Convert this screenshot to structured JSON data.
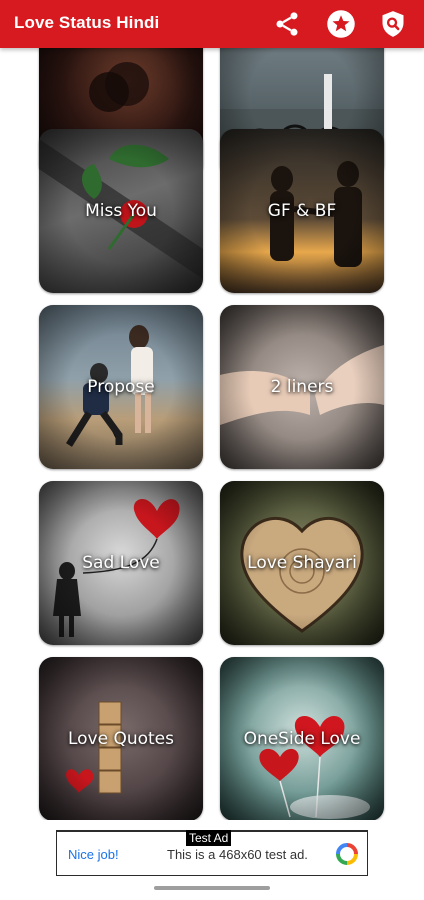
{
  "app": {
    "title": "Love Status Hindi",
    "accent_color": "#d71920",
    "actions": [
      {
        "icon": "share-icon"
      },
      {
        "icon": "star-icon"
      },
      {
        "icon": "search-icon"
      }
    ]
  },
  "categories": [
    {
      "label": "",
      "image": "couple-kiss-silhouette"
    },
    {
      "label": "",
      "image": "bicycles"
    },
    {
      "label": "Miss You",
      "image": "red-rose"
    },
    {
      "label": "GF & BF",
      "image": "couple-sunset"
    },
    {
      "label": "Propose",
      "image": "proposal-beach"
    },
    {
      "label": "2 liners",
      "image": "pinky-promise-hands"
    },
    {
      "label": "Sad Love",
      "image": "girl-heart-balloon"
    },
    {
      "label": "Love Shayari",
      "image": "wooden-heart"
    },
    {
      "label": "Love Quotes",
      "image": "love-blocks"
    },
    {
      "label": "OneSide Love",
      "image": "heart-balloons"
    }
  ],
  "ad": {
    "label": "Test Ad",
    "left_text": "Nice job!",
    "text": "This is a 468x60 test ad.",
    "icon": "ad-choices-icon"
  }
}
